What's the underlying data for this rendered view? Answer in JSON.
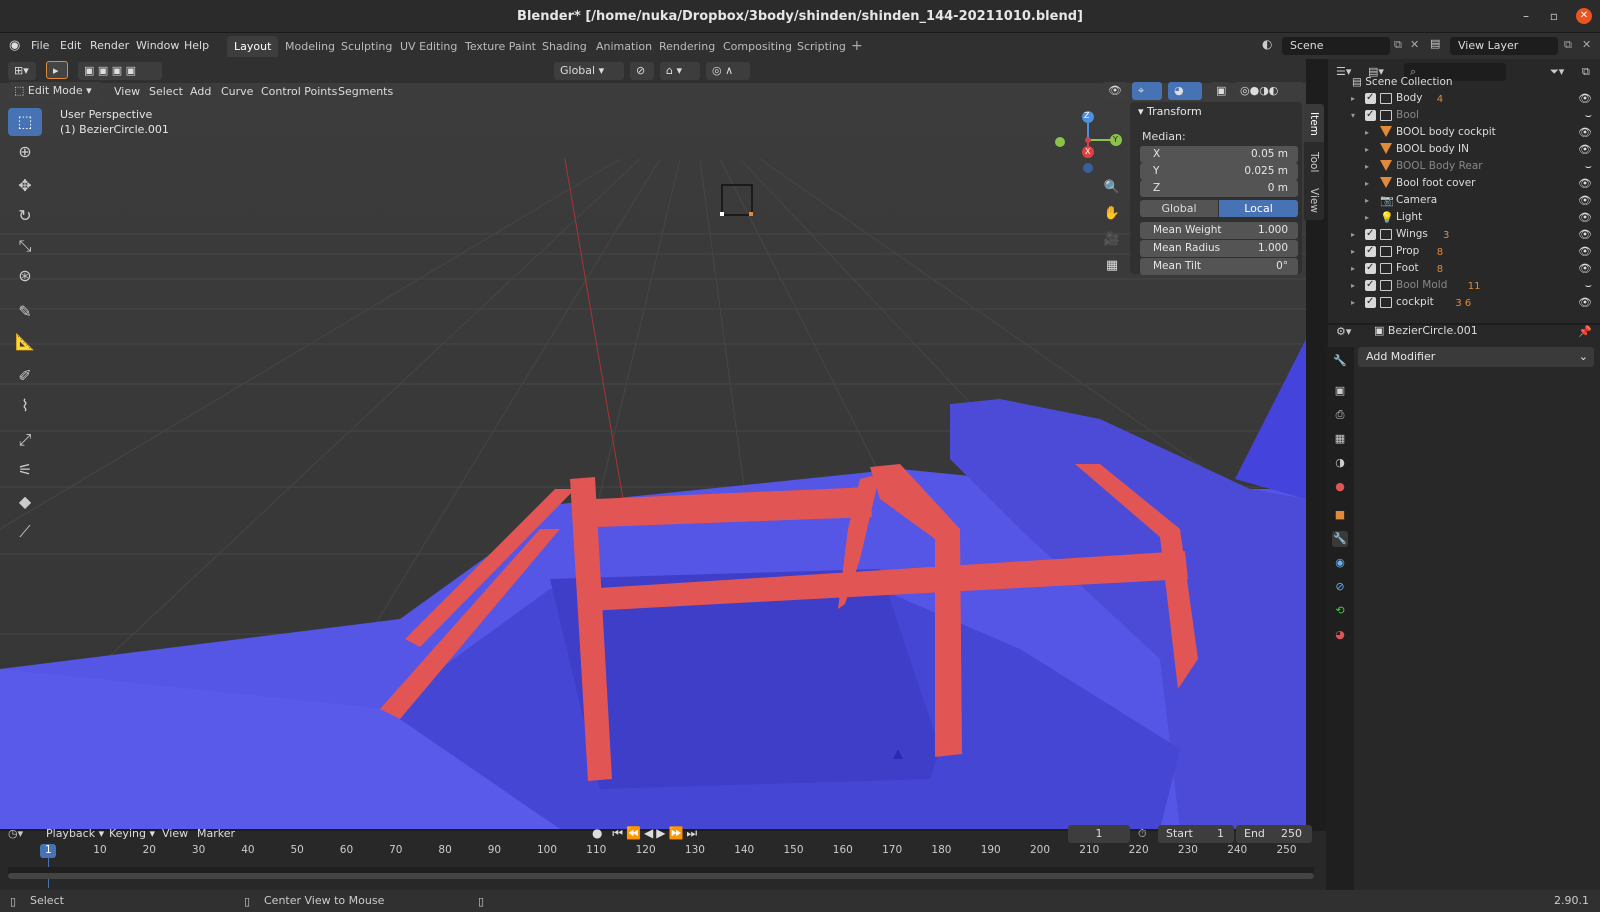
{
  "window": {
    "title": "Blender* [/home/nuka/Dropbox/3body/shinden/shinden_144-20211010.blend]",
    "close": "✕",
    "minimize": "–",
    "restore": "▫"
  },
  "menu": {
    "items": [
      "File",
      "Edit",
      "Render",
      "Window",
      "Help"
    ]
  },
  "workspaces": [
    "Layout",
    "Modeling",
    "Sculpting",
    "UV Editing",
    "Texture Paint",
    "Shading",
    "Animation",
    "Rendering",
    "Compositing",
    "Scripting"
  ],
  "scene": {
    "scene_name": "Scene",
    "view_layer": "View Layer"
  },
  "viewport": {
    "transform_orientation": "Global",
    "mode": "Edit Mode",
    "header_menu": [
      "View",
      "Select",
      "Add",
      "Curve",
      "Control Points",
      "Segments"
    ],
    "perspective": "User Perspective",
    "object_label": "(1) BezierCircle.001",
    "gizmo": {
      "z": "Z",
      "x": "X",
      "y": "Y"
    }
  },
  "npanel": {
    "title": "Transform",
    "median_label": "Median:",
    "fields": [
      {
        "k": "X",
        "v": "0.05 m"
      },
      {
        "k": "Y",
        "v": "0.025 m"
      },
      {
        "k": "Z",
        "v": "0 m"
      }
    ],
    "global": "Global",
    "local": "Local",
    "mean_fields": [
      {
        "k": "Mean Weight",
        "v": "1.000"
      },
      {
        "k": "Mean Radius",
        "v": "1.000"
      },
      {
        "k": "Mean Tilt",
        "v": "0°"
      }
    ],
    "tabs": [
      "Item",
      "Tool",
      "View"
    ]
  },
  "outliner": {
    "root": "Scene Collection",
    "rows": [
      {
        "label": "Body",
        "type": "coll",
        "badge": "4",
        "dim": false
      },
      {
        "label": "Bool",
        "type": "coll",
        "badge": "",
        "dim": true
      },
      {
        "label": "BOOL body cockpit",
        "type": "obj",
        "badge": "",
        "dim": false
      },
      {
        "label": "BOOL body IN",
        "type": "obj",
        "badge": "",
        "dim": false
      },
      {
        "label": "BOOL Body Rear",
        "type": "obj",
        "badge": "",
        "dim": true
      },
      {
        "label": "Bool foot cover",
        "type": "obj",
        "badge": "",
        "dim": false
      },
      {
        "label": "Camera",
        "type": "cam",
        "badge": "",
        "dim": false
      },
      {
        "label": "Light",
        "type": "light",
        "badge": "",
        "dim": false
      },
      {
        "label": "Wings",
        "type": "coll",
        "badge": "3",
        "dim": false
      },
      {
        "label": "Prop",
        "type": "coll",
        "badge": "8",
        "dim": false
      },
      {
        "label": "Foot",
        "type": "coll",
        "badge": "8",
        "dim": false
      },
      {
        "label": "Bool Mold",
        "type": "coll",
        "badge": "11",
        "dim": true
      },
      {
        "label": "cockpit",
        "type": "coll",
        "badge": "3 6",
        "dim": false
      }
    ]
  },
  "properties": {
    "object": "BezierCircle.001",
    "add_modifier": "Add Modifier"
  },
  "timeline": {
    "menu": [
      "Playback",
      "Keying",
      "View",
      "Marker"
    ],
    "current_frame": "1",
    "start_label": "Start",
    "start": "1",
    "end_label": "End",
    "end": "250",
    "ticks": [
      "1",
      "10",
      "20",
      "30",
      "40",
      "50",
      "60",
      "70",
      "80",
      "90",
      "100",
      "110",
      "120",
      "130",
      "140",
      "150",
      "160",
      "170",
      "180",
      "190",
      "200",
      "210",
      "220",
      "230",
      "240",
      "250"
    ]
  },
  "status": {
    "left": "Select",
    "middle": "Center View to Mouse",
    "version": "2.90.1"
  }
}
